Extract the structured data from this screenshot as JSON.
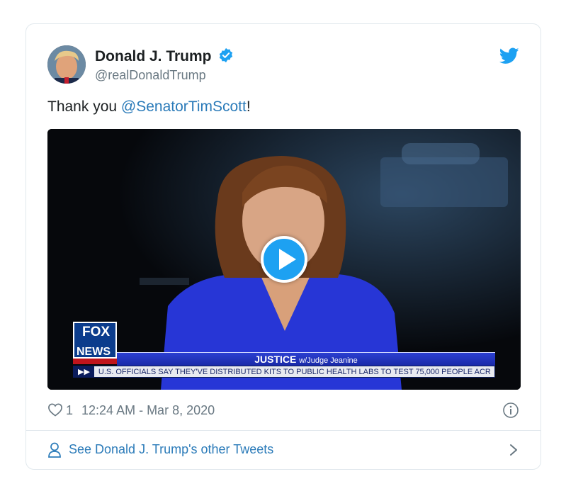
{
  "tweet": {
    "author": {
      "display_name": "Donald J. Trump",
      "handle": "@realDonaldTrump",
      "verified": true,
      "avatar_icon": "user-avatar"
    },
    "text_prefix": "Thank you ",
    "mention": "@SenatorTimScott",
    "text_suffix": "!",
    "media": {
      "type": "video",
      "play_icon": "play-icon",
      "overlay": {
        "logo_line1": "FOX",
        "logo_line2": "NEWS",
        "show_title": "JUSTICE",
        "show_subtitle": "w/Judge Jeanine",
        "ticker_arrow": "▶▶",
        "ticker_text": "U.S. OFFICIALS SAY THEY'VE DISTRIBUTED KITS TO PUBLIC HEALTH LABS TO TEST 75,000 PEOPLE ACR"
      }
    },
    "likes": "1",
    "timestamp": "12:24 AM - Mar 8, 2020",
    "footer_link": "See Donald J. Trump's other Tweets"
  },
  "colors": {
    "link": "#2b7bb9",
    "twitter_blue": "#1da1f2",
    "muted": "#697882",
    "border": "#e1e8ed"
  }
}
